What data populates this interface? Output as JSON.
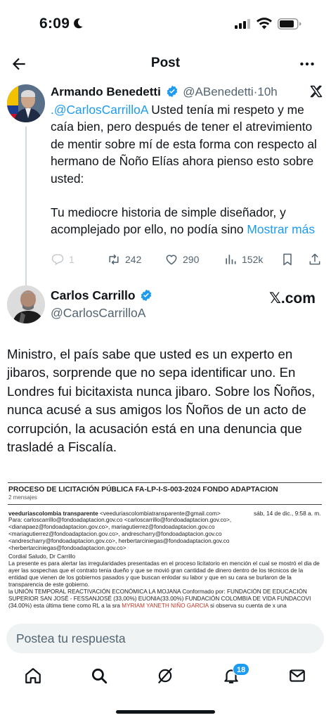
{
  "status_bar": {
    "time": "6:09"
  },
  "header": {
    "title": "Post"
  },
  "parent_tweet": {
    "author_name": "Armando Benedetti",
    "handle": "@ABenedetti",
    "separator": "·",
    "age": "10h",
    "mention": ".@CarlosCarrilloA",
    "text_1": " Usted tenía mi respeto y me caía bien, pero después de tener el atrevimiento de mentir sobre mí de esta forma con respecto al hermano de Ñoño Elías ahora pienso esto sobre usted:",
    "text_2": "Tu mediocre historia de simple diseñador, y acomplejado por ello, no podía sino ",
    "show_more": "Mostrar más",
    "replies": "1",
    "retweets": "242",
    "likes": "290",
    "views": "152k"
  },
  "main_tweet": {
    "author_name": "Carlos Carrillo",
    "handle": "@CarlosCarrilloA",
    "source_label": "𝕏.com",
    "text": "Ministro, el país sabe que usted es un experto en jibaros, sorprende que no sepa identificar uno. En Londres fui bicitaxista nunca jibaro. Sobre los Ñoños, nunca acusé a sus amigos los Ñoños de un acto de corrupción, la acusación está en una denuncia que trasladé a Fiscalía."
  },
  "attached_email": {
    "subject": "PROCESO DE LICITACIÓN PÚBLICA FA-LP-I-S-003-2024 FONDO ADAPTACION",
    "message_count": "2 mensajes",
    "sender_name": "veeduriascolombia transparente",
    "sender_email": "<veeduriascolombiatransparente@gmail.com>",
    "date": "sáb, 14 de dic., 9:58 a. m.",
    "recipients": "Para: carloscarrillo@fondoadaptacion.gov.co <carloscarrillo@fondoadaptacion.gov.co>, <dianapaez@fondoadaptacion.gov.co>, mariagutierrez@fondoadaptacion.gov.co <mariagutierrez@fondoadaptacion.gov.co>, andrescharry@fondoadaptacion.gov.co <andrescharry@fondoadaptacion.gov.co>, herbertarciniegas@fondoadaptacion.gov.co <herbertarciniegas@fondoadaptacion.gov.co>",
    "greeting": "Cordial Saludo, Dr Carrillo",
    "paragraph": "La presente es para alertar las irregularidades presentadas en el proceso licitatorio en mención el cual se mostró el dia de ayer las sospechas que el contrato tenia dueño y que se movió gran cantidad de dinero dentro de los técnicos de la entidad que vienen de los gobiernos pasados y que buscan enlodar su labor y que en su cara se burlaron de la transparencia de este gobierno.",
    "paragraph_2_start": "la  UNIÓN TEMPORAL REACTIVACIÓN ECONÓMICA LA MOJANA Conformado por: FUNDACIÓN DE EDUCACIÓN SUPERIOR SAN JOSÉ - FESSANJOSÉ (33,00%) EUONIA(33.00%) FUNDACIÓN COLOMBIA DE VIDA FUNDACOVI (34.00%) esta última tiene como RL a la sra ",
    "highlighted_name": "MYRIAM YANETH NIÑO GARCIA",
    "paragraph_2_end": " si observa su cuenta de x una"
  },
  "reply_bar": {
    "placeholder": "Postea tu respuesta"
  },
  "bottom_nav": {
    "items": [
      "home-icon",
      "search-icon",
      "grok-icon",
      "notifications-icon",
      "messages-icon"
    ],
    "notification_badge": "18"
  },
  "colors": {
    "accent": "#1d9bf0",
    "text_primary": "#0f1419",
    "text_secondary": "#536471",
    "highlight_red": "#c0392b"
  }
}
